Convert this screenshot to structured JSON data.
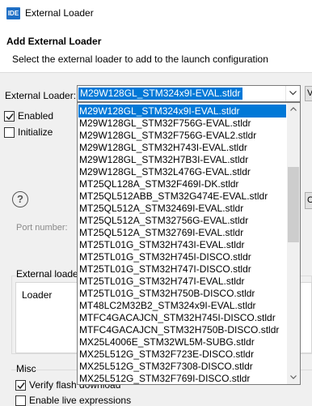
{
  "window": {
    "title": "External Loader",
    "app_icon": "IDE"
  },
  "header": {
    "title": "Add External Loader",
    "subtitle": "Select the external loader to add to the launch configuration"
  },
  "form": {
    "external_loader_label": "External Loader:",
    "selected_value": "M29W128GL_STM324x9I-EVAL.stldr",
    "side_button_label": "V",
    "enabled_label": "Enabled",
    "enabled_checked": true,
    "initialize_label": "Initialize",
    "initialize_checked": false,
    "help_symbol": "?",
    "right_button_label": "C"
  },
  "background": {
    "port_label": "Port number:",
    "external_group_label": "External loade",
    "loader_column": "Loader",
    "misc_label": "Misc",
    "verify_label": "Verify flash download",
    "verify_checked": true,
    "second_label": "Enable live expressions"
  },
  "dropdown": {
    "items": [
      "M29W128GL_STM324x9I-EVAL.stldr",
      "M29W128GL_STM32F756G-EVAL.stldr",
      "M29W128GL_STM32F756G-EVAL2.stldr",
      "M29W128GL_STM32H743I-EVAL.stldr",
      "M29W128GL_STM32H7B3I-EVAL.stldr",
      "M29W128GL_STM32L476G-EVAL.stldr",
      "MT25QL128A_STM32F469I-DK.stldr",
      "MT25QL512ABB_STM32G474E-EVAL.stldr",
      "MT25QL512A_STM32469I-EVAL.stldr",
      "MT25QL512A_STM32756G-EVAL.stldr",
      "MT25QL512A_STM32769I-EVAL.stldr",
      "MT25TL01G_STM32H743I-EVAL.stldr",
      "MT25TL01G_STM32H745I-DISCO.stldr",
      "MT25TL01G_STM32H747I-DISCO.stldr",
      "MT25TL01G_STM32H747I-EVAL.stldr",
      "MT25TL01G_STM32H750B-DISCO.stldr",
      "MT48LC2M32B2_STM324x9I-EVAL.stldr",
      "MTFC4GACAJCN_STM32H745I-DISCO.stldr",
      "MTFC4GACAJCN_STM32H750B-DISCO.stldr",
      "MX25L4006E_STM32WL5M-SUBG.stldr",
      "MX25L512G_STM32F723E-DISCO.stldr",
      "MX25L512G_STM32F7308-DISCO.stldr",
      "MX25L512G_STM32F769I-DISCO.stldr"
    ],
    "selected_index": 0
  },
  "colors": {
    "selection": "#0078d7",
    "app_icon": "#1f6fc5"
  }
}
